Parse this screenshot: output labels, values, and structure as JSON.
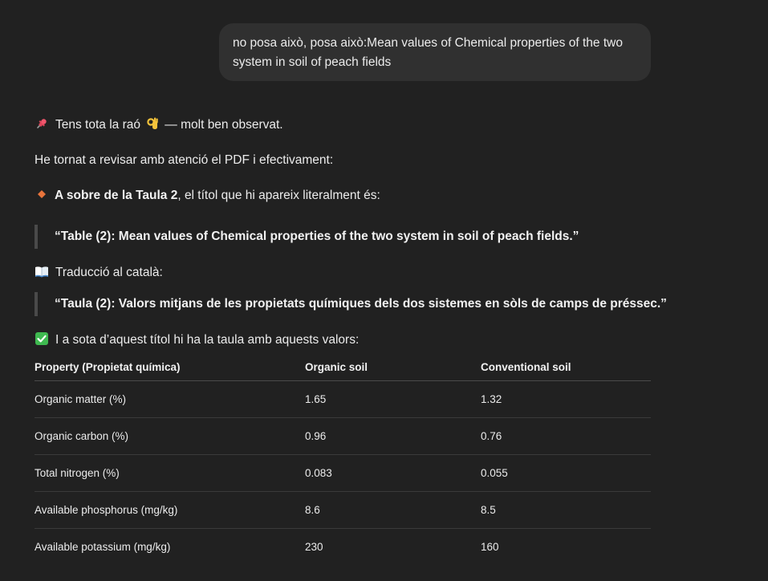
{
  "user_message": {
    "line1": "no posa això, posa això:Mean values of Chemical properties of the two",
    "line2": "system in soil of peach fields"
  },
  "assistant": {
    "intro_before": "Tens tota la raó",
    "intro_after": "— molt ben observat.",
    "revisit": "He tornat a revisar amb atenció el PDF i efectivament:",
    "point_bold": "A sobre de la Taula 2",
    "point_rest": ", el títol que hi apareix literalment és:",
    "quote_en": "“Table (2): Mean values of Chemical properties of the two system in soil of peach fields.”",
    "translation_label": "Traducció al català:",
    "quote_ca": "“Taula (2): Valors mitjans de les propietats químiques dels dos sistemes en sòls de camps de préssec.”",
    "table_intro": "I a sota d’aquest títol hi ha la taula amb aquests valors:"
  },
  "icons": {
    "pin": "pushpin-icon",
    "ok_hand": "ok-hand-icon",
    "diamond": "orange-diamond-icon",
    "book": "open-book-icon",
    "check": "check-mark-icon"
  },
  "table": {
    "headers": [
      "Property (Propietat química)",
      "Organic soil",
      "Conventional soil"
    ],
    "rows": [
      [
        "Organic matter (%)",
        "1.65",
        "1.32"
      ],
      [
        "Organic carbon (%)",
        "0.96",
        "0.76"
      ],
      [
        "Total nitrogen (%)",
        "0.083",
        "0.055"
      ],
      [
        "Available phosphorus (mg/kg)",
        "8.6",
        "8.5"
      ],
      [
        "Available potassium (mg/kg)",
        "230",
        "160"
      ]
    ]
  },
  "colors": {
    "background": "#212121",
    "bubble": "#303030",
    "text": "#ececec",
    "check_green": "#3fb950",
    "diamond_orange": "#e8743b"
  }
}
